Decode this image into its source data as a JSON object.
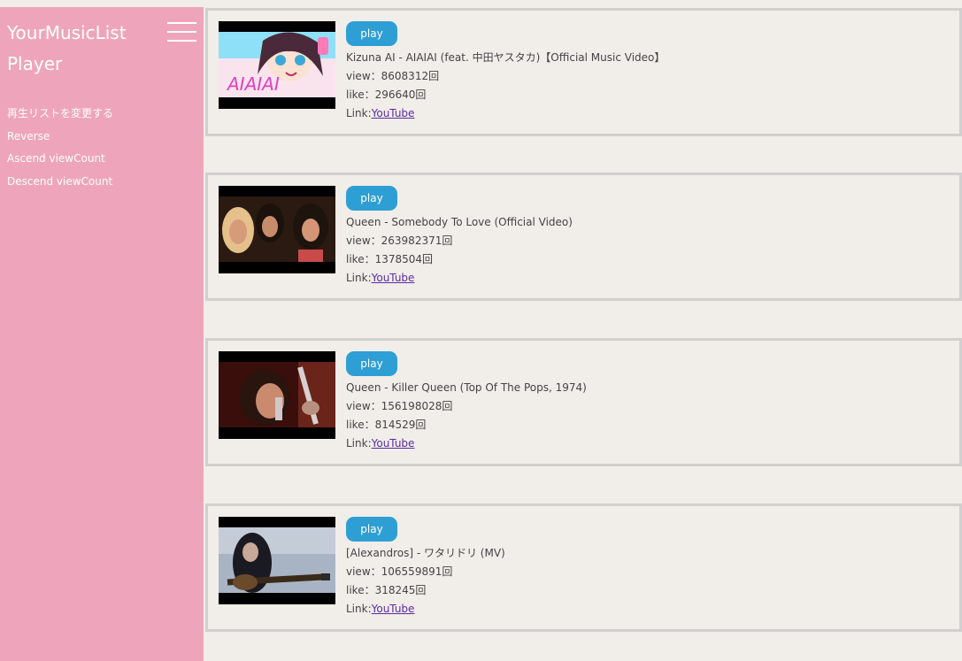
{
  "app": {
    "title_line1": "YourMusicList",
    "title_line2": "Player"
  },
  "sidebar": {
    "items": [
      {
        "label": "再生リストを変更する"
      },
      {
        "label": "Reverse"
      },
      {
        "label": "Ascend viewCount"
      },
      {
        "label": "Descend viewCount"
      }
    ]
  },
  "labels": {
    "play": "play",
    "view_prefix": "view：",
    "like_prefix": "like：",
    "link_prefix": "Link:",
    "link_text": "YouTube",
    "count_suffix": "回"
  },
  "videos": [
    {
      "title": "Kizuna AI - AIAIAI (feat. 中田ヤスタカ)【Official Music Video】",
      "views": "8608312",
      "likes": "296640",
      "thumb_colors": [
        "#f7a6d7",
        "#6cd3f0",
        "#ffffff"
      ]
    },
    {
      "title": "Queen - Somebody To Love (Official Video)",
      "views": "263982371",
      "likes": "1378504",
      "thumb_colors": [
        "#3a2418",
        "#d89c78",
        "#7a4a2a"
      ]
    },
    {
      "title": "Queen - Killer Queen (Top Of The Pops, 1974)",
      "views": "156198028",
      "likes": "814529",
      "thumb_colors": [
        "#2a0a08",
        "#a8382a",
        "#e0c8b8"
      ]
    },
    {
      "title": "[Alexandros] - ワタリドリ (MV)",
      "views": "106559891",
      "likes": "318245",
      "thumb_colors": [
        "#7c8fa8",
        "#1c1c24",
        "#b8c4d2"
      ]
    }
  ]
}
